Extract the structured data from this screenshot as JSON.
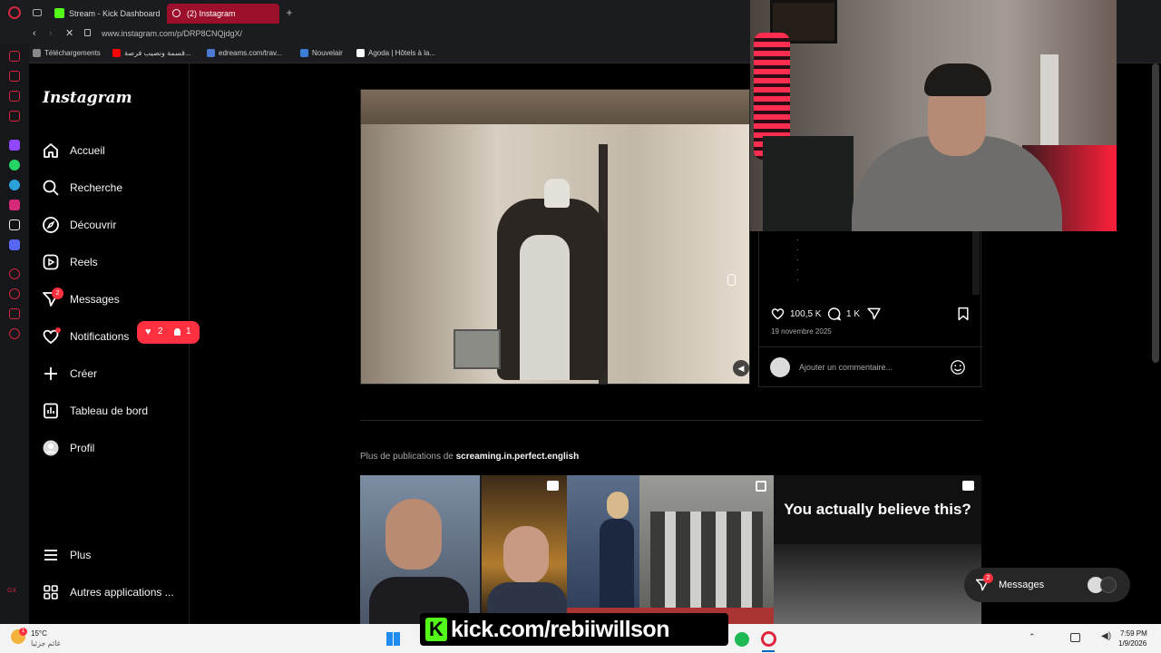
{
  "browser": {
    "tabs": [
      {
        "label": "Stream - Kick Dashboard"
      },
      {
        "label": "(2) Instagram"
      }
    ],
    "url": "www.instagram.com/p/DRP8CNQjdgX/",
    "bookmarks": [
      {
        "label": "Téléchargements"
      },
      {
        "label": "قسمة ونصيب فرصة..."
      },
      {
        "label": "edreams.com/trav..."
      },
      {
        "label": "Nouvelair"
      },
      {
        "label": "Agoda | Hôtels à la..."
      }
    ]
  },
  "sidebar": {
    "logo": "Instagram",
    "items": [
      {
        "label": "Accueil"
      },
      {
        "label": "Recherche"
      },
      {
        "label": "Découvrir"
      },
      {
        "label": "Reels"
      },
      {
        "label": "Messages",
        "badge": "2"
      },
      {
        "label": "Notifications"
      },
      {
        "label": "Créer"
      },
      {
        "label": "Tableau de bord"
      },
      {
        "label": "Profil"
      },
      {
        "label": "Plus"
      },
      {
        "label": "Autres applications ..."
      }
    ],
    "notif_pill": {
      "likes": "2",
      "follows": "1"
    }
  },
  "post": {
    "likes": "100,5 K",
    "comments": "1 K",
    "date": "19 novembre 2025",
    "comment_placeholder": "Ajouter un commentaire..."
  },
  "more": {
    "prefix": "Plus de publications de ",
    "user": "screaming.in.perfect.english",
    "thumb4_text": "You actually believe this?"
  },
  "messages_bar": {
    "label": "Messages",
    "badge": "2"
  },
  "overlay": {
    "kick_url": "kick.com/rebiiwillson"
  },
  "taskbar": {
    "weather_temp": "15°C",
    "weather_desc": "غائم جزئيا",
    "time": "7:59 PM",
    "date": "1/9/2026"
  },
  "colors": {
    "accent": "#ff3040",
    "kick_green": "#53fc18",
    "opera_red": "#9c0f2b"
  }
}
